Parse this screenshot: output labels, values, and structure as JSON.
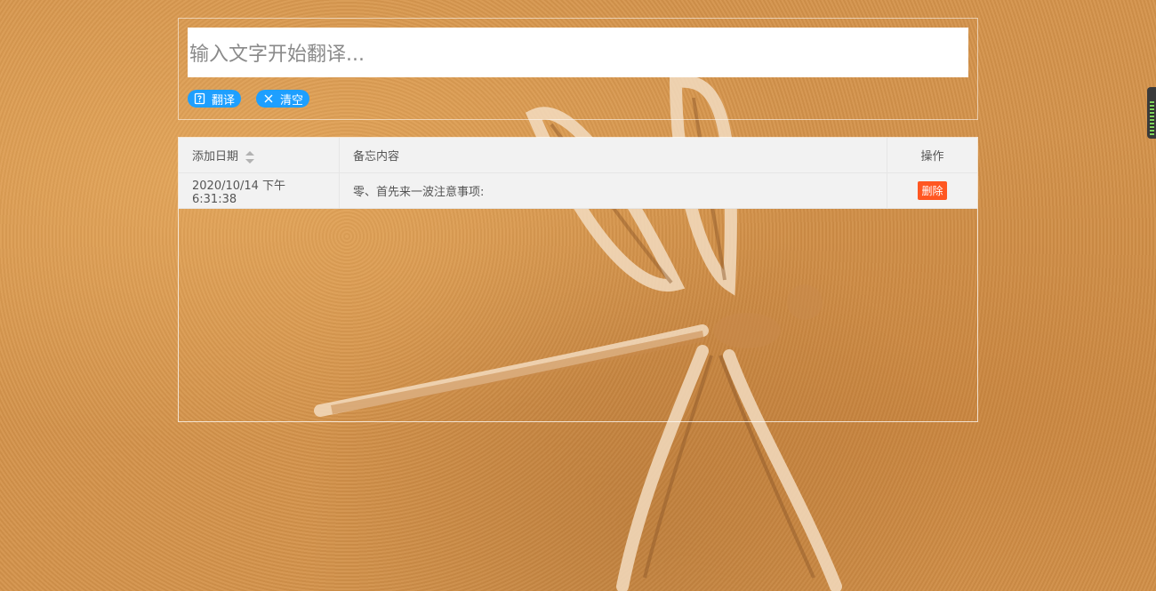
{
  "translator": {
    "input_placeholder": "输入文字开始翻译...",
    "input_value": "",
    "translate_label": "翻译",
    "clear_label": "清空",
    "translate_icon": "translate-icon",
    "clear_icon": "close-icon"
  },
  "memo_table": {
    "headers": {
      "date": "添加日期",
      "content": "备忘内容",
      "operation": "操作"
    },
    "rows": [
      {
        "date": "2020/10/14 下午6:31:38",
        "content": "零、首先来一波注意事项:",
        "action": "删除"
      }
    ]
  },
  "colors": {
    "accent": "#1e9fff",
    "danger": "#ff5722",
    "table_bg": "#f2f2f2",
    "background": "#d4934b"
  }
}
